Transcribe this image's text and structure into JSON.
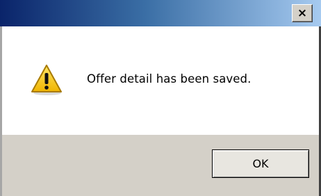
{
  "window": {
    "title": "",
    "close_label": "×"
  },
  "message": {
    "icon": "warning-icon",
    "text": "Offer detail has been saved."
  },
  "buttons": {
    "ok_label": "OK"
  },
  "colors": {
    "titlebar_start": "#0a246a",
    "titlebar_end": "#a6caf0",
    "dialog_face": "#d4d0c8",
    "content_bg": "#ffffff",
    "warning_yellow": "#f5c400"
  }
}
